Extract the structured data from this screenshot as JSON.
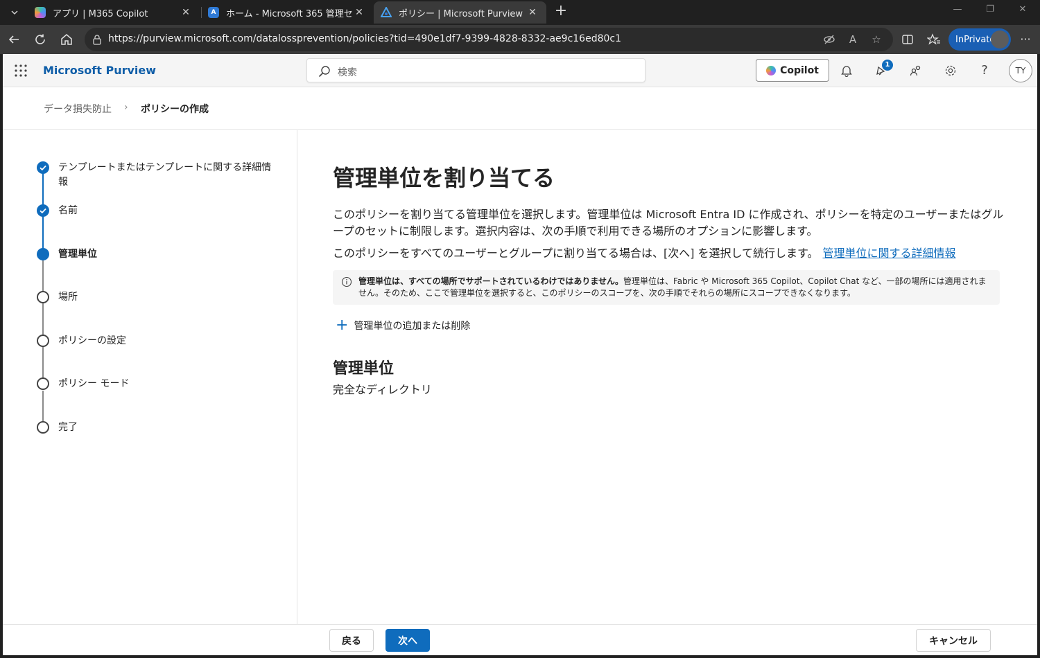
{
  "browser": {
    "tabs": [
      {
        "title": "アプリ | M365 Copilot",
        "active": false
      },
      {
        "title": "ホーム - Microsoft 365 管理センター",
        "active": false
      },
      {
        "title": "ポリシー | Microsoft Purview",
        "active": true
      }
    ],
    "url": "https://purview.microsoft.com/datalossprevention/policies?tid=490e1df7-9399-4828-8332-ae9c16ed80c1",
    "inprivate_label": "InPrivate"
  },
  "header": {
    "brand": "Microsoft Purview",
    "search_placeholder": "検索",
    "copilot_label": "Copilot",
    "notification_count": "1",
    "user_initials": "TY"
  },
  "breadcrumb": {
    "parent": "データ損失防止",
    "separator": "›",
    "current": "ポリシーの作成"
  },
  "steps": [
    {
      "label": "テンプレートまたはテンプレートに関する詳細情報",
      "status": "done"
    },
    {
      "label": "名前",
      "status": "done"
    },
    {
      "label": "管理単位",
      "status": "current"
    },
    {
      "label": "場所",
      "status": "todo"
    },
    {
      "label": "ポリシーの設定",
      "status": "todo"
    },
    {
      "label": "ポリシー モード",
      "status": "todo"
    },
    {
      "label": "完了",
      "status": "todo"
    }
  ],
  "main": {
    "title": "管理単位を割り当てる",
    "description": "このポリシーを割り当てる管理単位を選択します。管理単位は Microsoft Entra ID に作成され、ポリシーを特定のユーザーまたはグループのセットに制限します。選択内容は、次の手順で利用できる場所のオプションに影響します。",
    "description2": "このポリシーをすべてのユーザーとグループに割り当てる場合は、[次へ] を選択して続行します。",
    "learn_more_link": "管理単位に関する詳細情報",
    "info_bold": "管理単位は、すべての場所でサポートされているわけではありません。",
    "info_text": "管理単位は、Fabric や Microsoft 365 Copilot、Copilot Chat など、一部の場所には適用されません。そのため、ここで管理単位を選択すると、このポリシーのスコープを、次の手順でそれらの場所にスコープできなくなります。",
    "add_remove_label": "管理単位の追加または削除",
    "section_title": "管理単位",
    "section_value": "完全なディレクトリ"
  },
  "footer": {
    "back_label": "戻る",
    "next_label": "次へ",
    "cancel_label": "キャンセル"
  },
  "colors": {
    "accent": "#0f6cbd",
    "brand_text": "#0f5ea8",
    "inprivate": "#1a5fb4"
  }
}
